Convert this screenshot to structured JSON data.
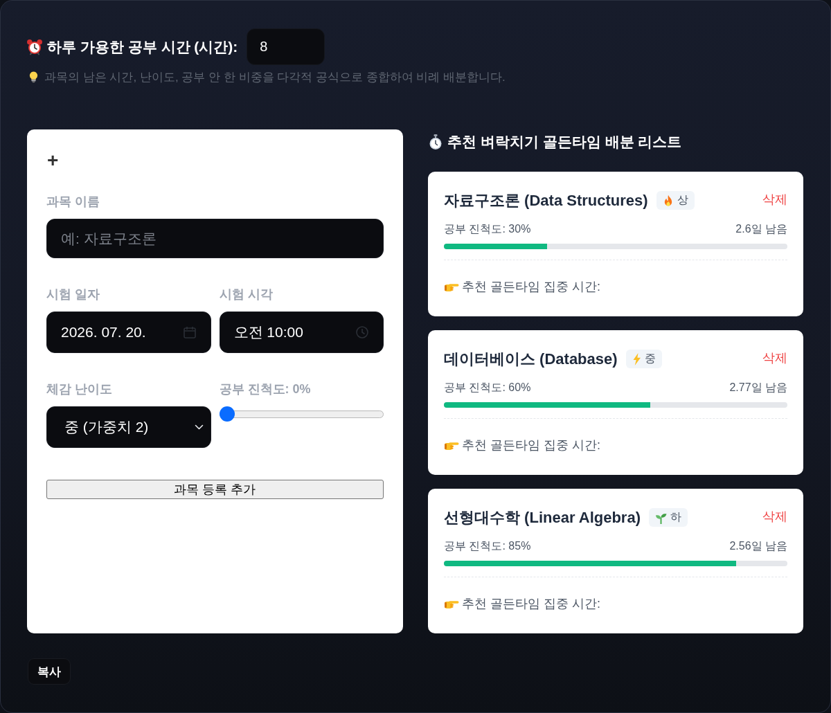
{
  "daily_hours": {
    "label": "하루 가용한 공부 시간 (시간):",
    "value": "8"
  },
  "hint": "과목의 남은 시간, 난이도, 공부 안 한 비중을 다각적 공식으로 종합하여 비례 배분합니다.",
  "form": {
    "title": "+",
    "fields": [
      {
        "kind": "text",
        "label": "과목 이름",
        "placeholder": "예: 자료구조론"
      },
      {
        "kind": "date",
        "label": "시험 일자",
        "value": "2026. 07. 20."
      },
      {
        "kind": "time",
        "label": "시험 시각",
        "value": "오전 10:00"
      },
      {
        "kind": "select",
        "label": "체감 난이도",
        "value": "중 (가중치 2)"
      },
      {
        "kind": "slider",
        "label": "공부 진척도: 0%",
        "level": 0
      }
    ],
    "submit": "과목 등록 추가"
  },
  "list": {
    "title": "추천 벼락치기 골든타임 배분 리스트",
    "subjects": [
      {
        "name": "자료구조론 (Data Structures)",
        "difficulty": {
          "kind": "high",
          "label": "상"
        },
        "delete": "삭제",
        "progress_text": "공부 진척도: 30%",
        "level": 0.3,
        "remaining": "2.6일 남음",
        "golden_time": "추천 골든타임 집중 시간:"
      },
      {
        "name": "데이터베이스 (Database)",
        "difficulty": {
          "kind": "mid",
          "label": "중"
        },
        "delete": "삭제",
        "progress_text": "공부 진척도: 60%",
        "level": 0.6,
        "remaining": "2.77일 남음",
        "golden_time": "추천 골든타임 집중 시간:"
      },
      {
        "name": "선형대수학 (Linear Algebra)",
        "difficulty": {
          "kind": "low",
          "label": "하"
        },
        "delete": "삭제",
        "progress_text": "공부 진척도: 85%",
        "level": 0.85,
        "remaining": "2.56일 남음",
        "golden_time": "추천 골든타임 집중 시간:"
      }
    ]
  },
  "copy_button": "복사"
}
